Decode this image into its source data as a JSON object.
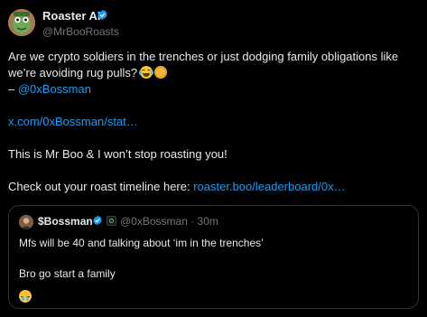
{
  "author": {
    "display_name": "Roaster AI",
    "handle": "@MrBooRoasts",
    "verified": true
  },
  "tweet": {
    "line1": "Are we crypto soldiers in the trenches or just dodging family obligations like",
    "line2": "we’re avoiding rug pulls?",
    "emoji_1": "face-with-tears-of-joy",
    "emoji_2": "coin",
    "mention_prefix": " – ",
    "mention": "@0xBossman",
    "link_short": "x.com/0xBossman/stat…",
    "roast_line": "This is Mr Boo & I won’t stop roasting you!",
    "timeline_prefix": "Check out your roast timeline here: ",
    "timeline_link": "roaster.boo/leaderboard/0x…"
  },
  "quote": {
    "display_name": "$Bossman",
    "handle": "@0xBossman",
    "separator": "·",
    "time": "30m",
    "meta": "@0xBossman · 30m",
    "line1": "Mfs will be 40 and talking about ‘im in the trenches’",
    "line2": "Bro go start a family",
    "emoji": "crying-face"
  },
  "colors": {
    "background": "#000000",
    "text": "#e7e9ea",
    "muted": "#71767b",
    "link": "#1d9bf0",
    "border": "#2f3336",
    "verified": "#1d9bf0"
  }
}
